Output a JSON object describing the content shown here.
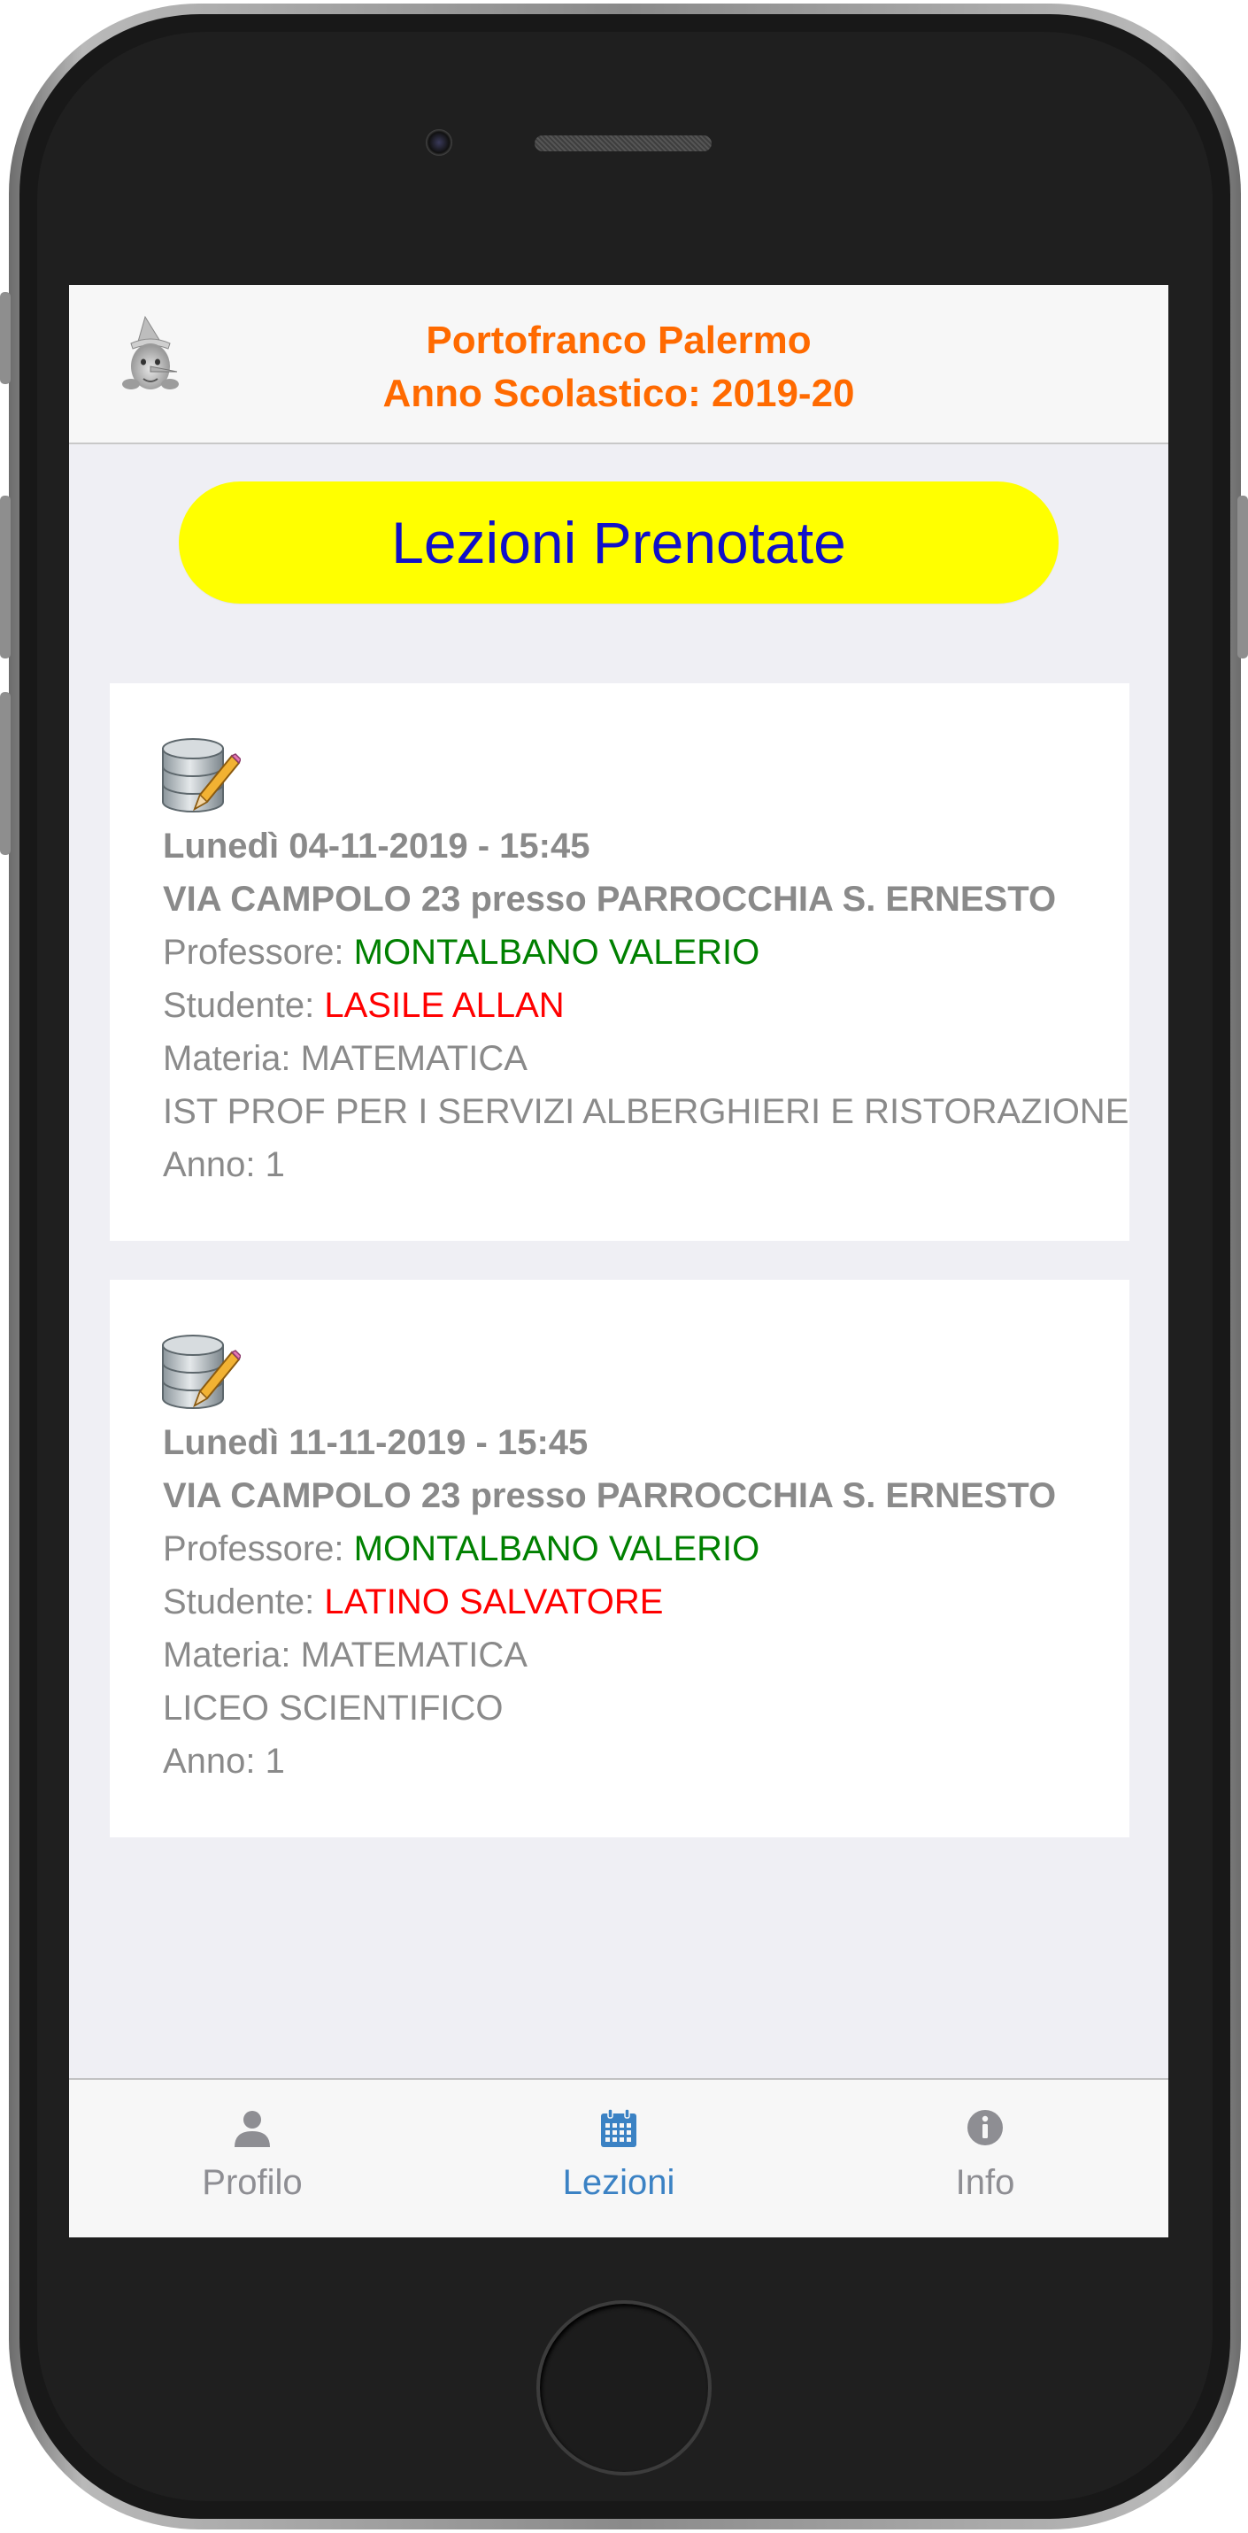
{
  "header": {
    "title_line1": "Portofranco Palermo",
    "title_line2": "Anno Scolastico: 2019-20"
  },
  "page_title": "Lezioni Prenotate",
  "lessons": [
    {
      "date": "Lunedì 04-11-2019 - 15:45",
      "location": "VIA CAMPOLO 23 presso PARROCCHIA S. ERNESTO",
      "professor_label": "Professore: ",
      "professor": "MONTALBANO VALERIO",
      "student_label": "Studente: ",
      "student": "LASILE ALLAN",
      "subject": "Materia: MATEMATICA",
      "school": "IST PROF PER I SERVIZI ALBERGHIERI E RISTORAZIONE",
      "year": "Anno: 1"
    },
    {
      "date": "Lunedì 11-11-2019 - 15:45",
      "location": "VIA CAMPOLO 23 presso PARROCCHIA S. ERNESTO",
      "professor_label": "Professore: ",
      "professor": "MONTALBANO VALERIO",
      "student_label": "Studente: ",
      "student": "LATINO SALVATORE",
      "subject": "Materia: MATEMATICA",
      "school": "LICEO SCIENTIFICO",
      "year": "Anno: 1"
    }
  ],
  "tabbar": {
    "items": [
      {
        "label": "Profilo",
        "icon": "user-icon",
        "active": false
      },
      {
        "label": "Lezioni",
        "icon": "calendar-icon",
        "active": true
      },
      {
        "label": "Info",
        "icon": "info-icon",
        "active": false
      }
    ]
  },
  "colors": {
    "title": "#ff6a00",
    "pill_bg": "#ffff00",
    "pill_text": "#1010c8",
    "professor": "#008000",
    "student": "#ff0000",
    "tab_active": "#3b82c4",
    "tab_inactive": "#8e8e93"
  }
}
